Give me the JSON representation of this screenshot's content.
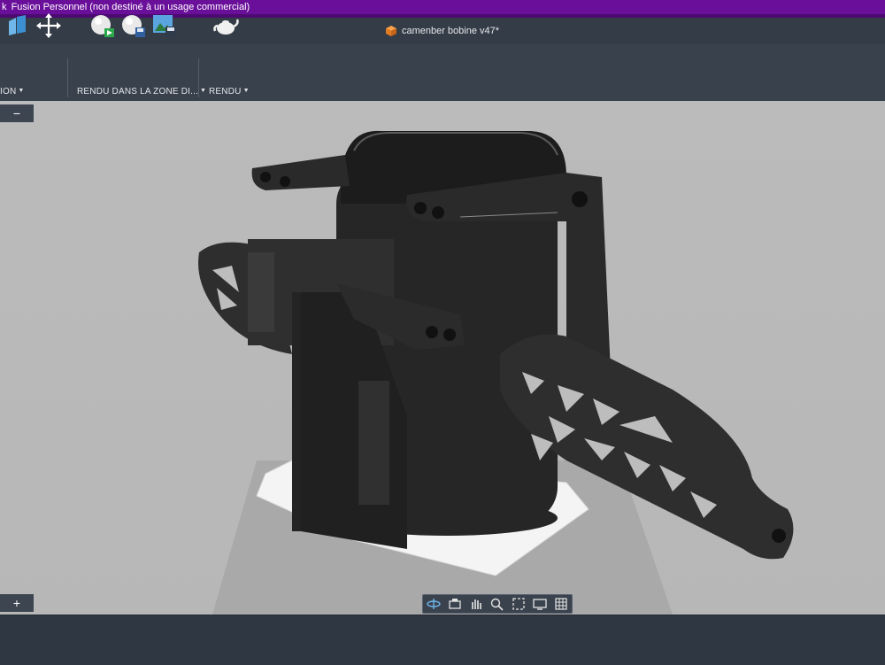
{
  "window": {
    "title": "Fusion Personnel (non destiné à un usage commercial)",
    "title_prefix_glyph": "k"
  },
  "document": {
    "tab_name": "camenber bobine v47*",
    "icon": "orange-cube-icon"
  },
  "toolbar": {
    "groups": [
      {
        "label": "ION",
        "icons": [
          "section-analysis-icon",
          "move-icon"
        ]
      },
      {
        "label": "RENDU DANS LA ZONE DI...",
        "icons": [
          "render-canvas-play-icon",
          "render-canvas-save-icon",
          "render-gallery-icon"
        ]
      },
      {
        "label": "RENDU",
        "icons": [
          "teapot-render-icon"
        ]
      }
    ]
  },
  "panels": {
    "collapse_top": "−",
    "expand_bottom": "+"
  },
  "navigation_bar": {
    "icons": [
      "orbit-icon",
      "look-at-icon",
      "pan-icon",
      "zoom-icon",
      "fit-icon",
      "display-settings-icon",
      "grid-settings-icon"
    ]
  },
  "colors": {
    "title_bar": "#6a0f9a",
    "toolbar": "#39414c",
    "viewport": "#bbbbbb",
    "model": "#2b2b2b",
    "base_plate": "#f2f2f2"
  }
}
